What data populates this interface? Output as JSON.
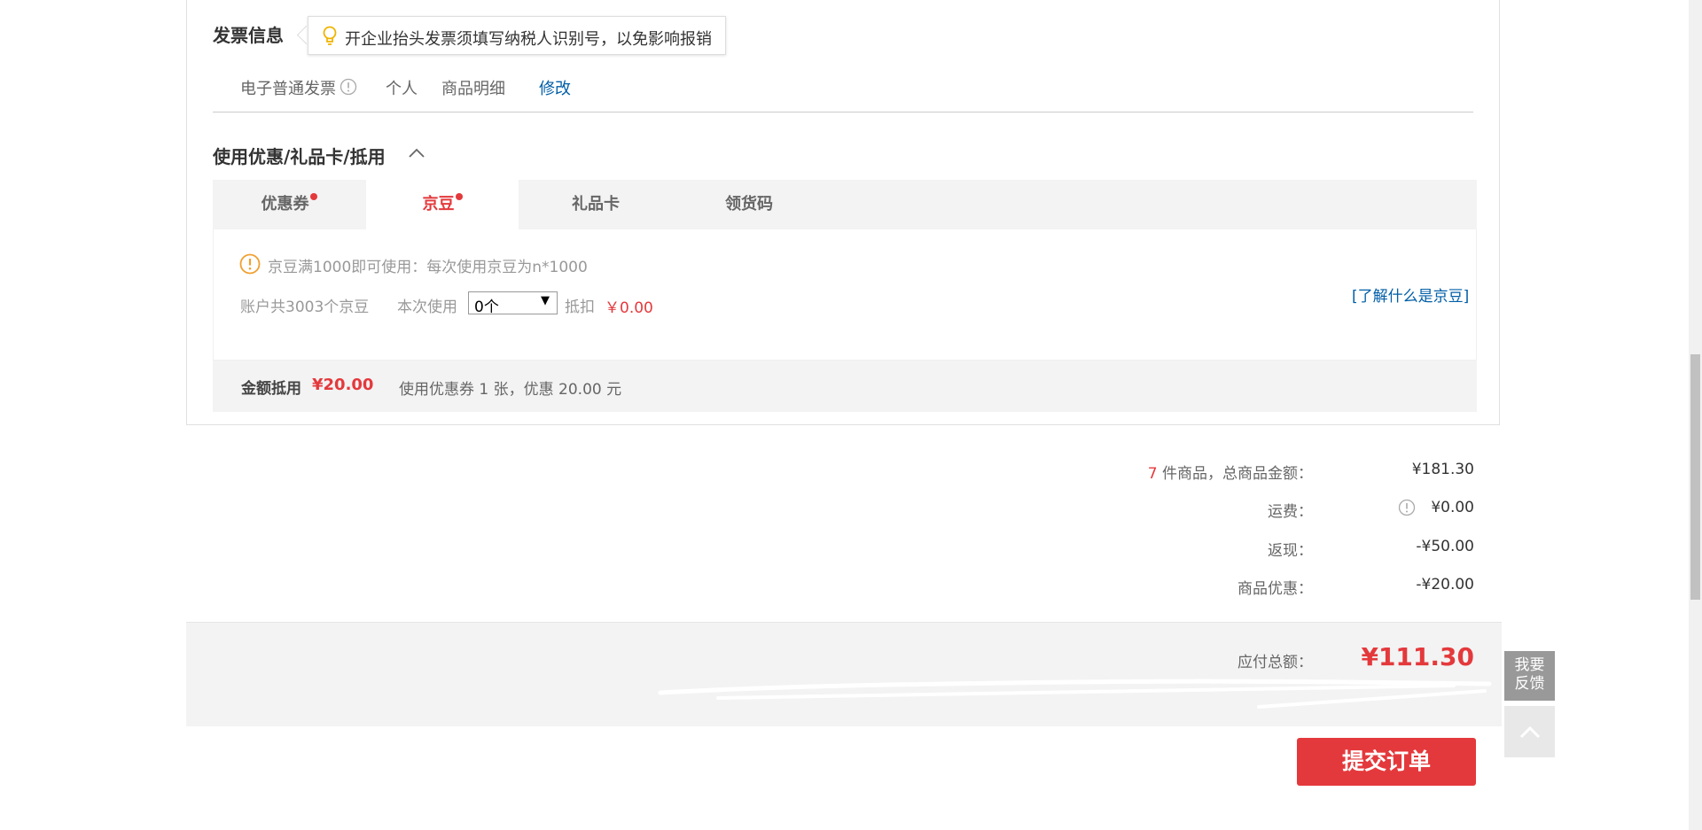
{
  "invoice": {
    "title": "发票信息",
    "tip": "开企业抬头发票须填写纳税人识别号，以免影响报销",
    "type": "电子普通发票",
    "holder": "个人",
    "content": "商品明细",
    "modify": "修改"
  },
  "coupons": {
    "title": "使用优惠/礼品卡/抵用",
    "tabs": [
      {
        "label": "优惠券",
        "dot": true
      },
      {
        "label": "京豆",
        "dot": true,
        "active": true
      },
      {
        "label": "礼品卡"
      },
      {
        "label": "领货码"
      }
    ],
    "bean": {
      "rule": "京豆满1000即可使用：每次使用京豆为n*1000",
      "account": "账户共3003个京豆",
      "use_label": "本次使用",
      "selected": "0个",
      "deduct_label": "抵扣",
      "deduct_value": "￥0.00",
      "learn": "[了解什么是京豆]"
    },
    "amount": {
      "label": "金额抵用",
      "value": "¥20.00",
      "desc": "使用优惠券 1 张，优惠 20.00 元"
    }
  },
  "summary": {
    "count": "7",
    "count_label": " 件商品，总商品金额：",
    "goods_value": "¥181.30",
    "shipping_label": "运费：",
    "shipping_value": "¥0.00",
    "cashback_label": "返现：",
    "cashback_value": "-¥50.00",
    "discount_label": "商品优惠：",
    "discount_value": "-¥20.00",
    "total_label": "应付总额：",
    "total_value": "¥111.30"
  },
  "actions": {
    "submit": "提交订单",
    "feedback_line1": "我要",
    "feedback_line2": "反馈"
  },
  "colors": {
    "accent": "#e4393c",
    "link": "#005ea7"
  }
}
